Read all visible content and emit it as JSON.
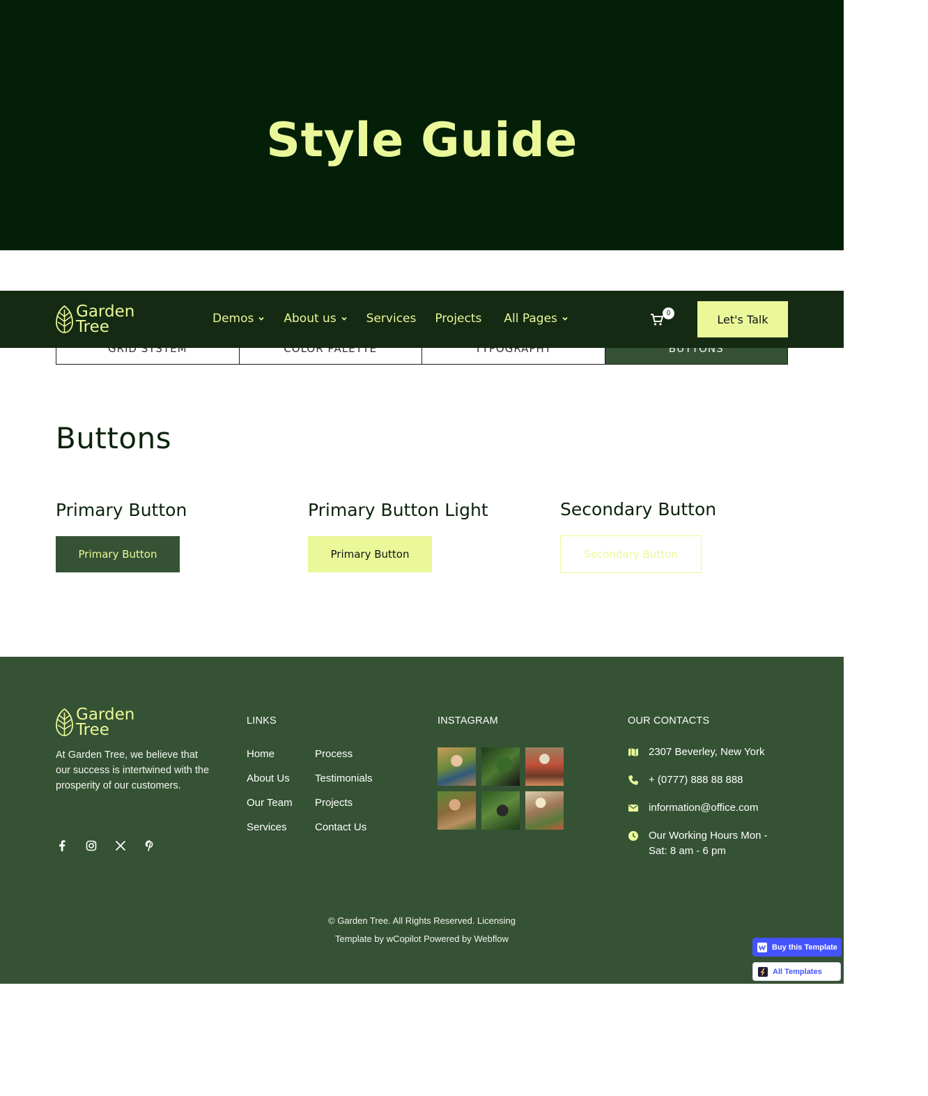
{
  "hero": {
    "title": "Style Guide"
  },
  "navbar": {
    "logo_line1": "Garden",
    "logo_line2": "Tree",
    "links": [
      {
        "label": "Demos",
        "has_dropdown": true
      },
      {
        "label": "About us",
        "has_dropdown": true
      },
      {
        "label": "Services",
        "has_dropdown": false
      },
      {
        "label": "Projects",
        "has_dropdown": false
      },
      {
        "label": "All Pages",
        "has_dropdown": true
      }
    ],
    "cart_count": "0",
    "cta_label": "Let's Talk"
  },
  "tabs": [
    {
      "label": "GRID SYSTEM",
      "active": false
    },
    {
      "label": "COLOR PALETTE",
      "active": false
    },
    {
      "label": "TYPOGRAPHY",
      "active": false
    },
    {
      "label": "BUTTONS",
      "active": true
    }
  ],
  "buttons_section": {
    "title": "Buttons",
    "columns": [
      {
        "heading": "Primary Button",
        "button_label": "Primary Button"
      },
      {
        "heading": "Primary Button Light",
        "button_label": "Primary Button"
      },
      {
        "heading": "Secondary Button",
        "button_label": "Secondary Button"
      }
    ]
  },
  "footer": {
    "logo_line1": "Garden",
    "logo_line2": "Tree",
    "about": "At Garden Tree, we believe that our success is intertwined with the prosperity of our customers.",
    "links_title": "LINKS",
    "links": [
      "Home",
      "Process",
      "About Us",
      "Testimonials",
      "Our Team",
      "Projects",
      "Services",
      "Contact Us"
    ],
    "instagram_title": "INSTAGRAM",
    "contacts_title": "OUR CONTACTS",
    "contacts": {
      "address": "2307 Beverley, New York",
      "phone": "+ (0777) 888 88 888",
      "email": "information@office.com",
      "hours": "Our Working Hours Mon - Sat: 8 am - 6 pm"
    },
    "copyright_line1": "© Garden Tree. All Rights Reserved. Licensing",
    "copyright_line2": "Template by wCopilot Powered by Webflow"
  },
  "badges": {
    "buy": "Buy this Template",
    "all": "All Templates"
  },
  "colors": {
    "hero_bg": "#031f08",
    "accent": "#eaf89a",
    "nav_bg": "#142a12",
    "primary_green": "#355234",
    "webflow_blue": "#4353ff"
  }
}
